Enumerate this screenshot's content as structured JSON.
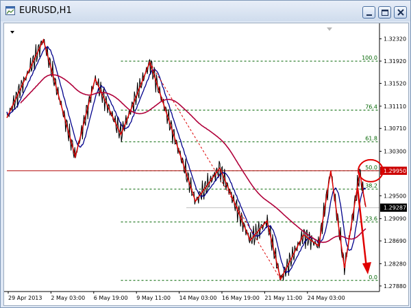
{
  "window": {
    "title": "EURUSD,H1",
    "controls": [
      "minimize",
      "maximize",
      "close"
    ],
    "icon": "chart-window-icon"
  },
  "chart_data": {
    "type": "line",
    "symbol": "EURUSD",
    "timeframe": "H1",
    "ylim": [
      1.2778,
      1.325
    ],
    "price_axis": [
      "1.32320",
      "1.31920",
      "1.31520",
      "1.31110",
      "1.30710",
      "1.30300",
      "1.29500",
      "1.29090",
      "1.28690",
      "1.28280",
      "1.27880"
    ],
    "time_axis": [
      "29 Apr 2013",
      "2 May 03:00",
      "6 May 19:00",
      "9 May 11:00",
      "14 May 03:00",
      "16 May 19:00",
      "21 May 11:00",
      "24 May 03:00"
    ],
    "highlighted_price": "1.29950",
    "current_price": "1.29287",
    "fibonacci": {
      "levels": [
        {
          "label": "100.0",
          "price": 1.3192
        },
        {
          "label": "76.4",
          "price": 1.3104
        },
        {
          "label": "61.8",
          "price": 1.3047
        },
        {
          "label": "50.0",
          "price": 1.2995
        },
        {
          "label": "38.2",
          "price": 1.2962
        },
        {
          "label": "23.6",
          "price": 1.2903
        },
        {
          "label": "0.0",
          "price": 1.2798
        }
      ]
    },
    "zigzag": [
      {
        "t": 0.0,
        "price": 1.309
      },
      {
        "t": 2.4,
        "price": 1.323
      },
      {
        "t": 3.4,
        "price": 1.313
      },
      {
        "t": 4.5,
        "price": 1.302
      },
      {
        "t": 5.8,
        "price": 1.316
      },
      {
        "t": 7.5,
        "price": 1.306
      },
      {
        "t": 9.4,
        "price": 1.319
      },
      {
        "t": 11.2,
        "price": 1.304
      },
      {
        "t": 12.4,
        "price": 1.294
      },
      {
        "t": 14.0,
        "price": 1.3
      },
      {
        "t": 16.0,
        "price": 1.287
      },
      {
        "t": 17.1,
        "price": 1.2905
      },
      {
        "t": 18.0,
        "price": 1.28
      },
      {
        "t": 19.5,
        "price": 1.288
      },
      {
        "t": 20.5,
        "price": 1.286
      },
      {
        "t": 21.3,
        "price": 1.2995
      },
      {
        "t": 22.2,
        "price": 1.282
      },
      {
        "t": 23.2,
        "price": 1.2992
      },
      {
        "t": 23.6,
        "price": 1.293
      }
    ],
    "series": [
      {
        "kind": "price",
        "color": "#000000"
      },
      {
        "kind": "fast-ma",
        "color": "#00008b"
      },
      {
        "kind": "slow-ma",
        "color": "#b0003a"
      },
      {
        "kind": "zigzag",
        "color": "#dd0000"
      }
    ],
    "annotations": [
      {
        "type": "circle",
        "color": "#e00000",
        "target": "50.0"
      },
      {
        "type": "down-arrow",
        "color": "#e00000"
      }
    ],
    "grid": false,
    "colors": {
      "background": "#ffffff",
      "fib_lines": "#006400",
      "zigzag": "#dd0000",
      "highlight_label_bg": "#cc0000",
      "current_label_bg": "#000000"
    }
  }
}
